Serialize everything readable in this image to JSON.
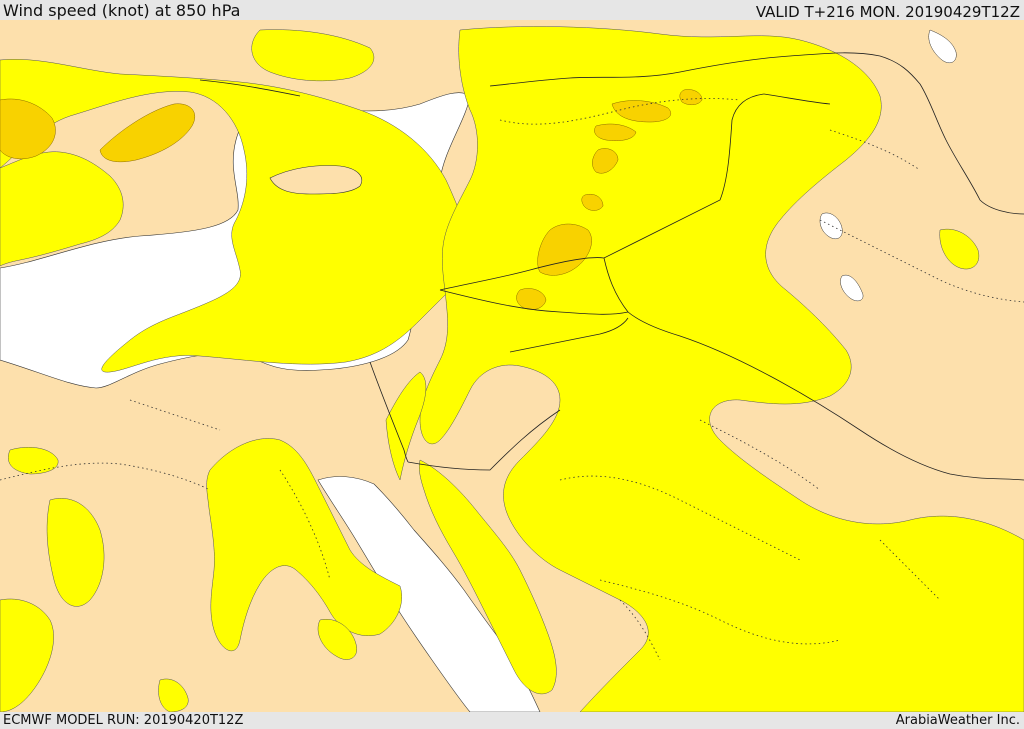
{
  "header": {
    "title": "Wind speed (knot) at 850 hPa",
    "valid": "VALID T+216 MON. 20190429T12Z"
  },
  "footer": {
    "model_run": "ECMWF MODEL RUN: 20190420T12Z",
    "credit": "ArabiaWeather Inc."
  },
  "legend_colors": {
    "land_low": "#fde0ac",
    "sea_low": "#ffffff",
    "band_yellow": "#ffff00",
    "band_orange": "#f8d200"
  }
}
